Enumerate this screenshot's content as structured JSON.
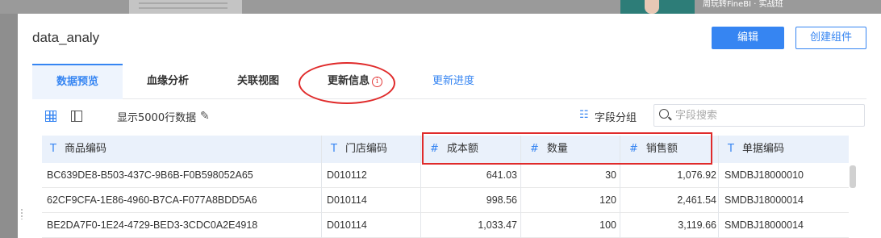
{
  "background": {
    "banner_text": "周玩转FineBI · 实战班"
  },
  "dialog": {
    "title": "data_analy",
    "edit_button": "编辑",
    "create_component_button": "创建组件"
  },
  "tabs": [
    {
      "label": "数据预览",
      "active": true
    },
    {
      "label": "血缘分析"
    },
    {
      "label": "关联视图"
    },
    {
      "label": "更新信息",
      "icon": "info-icon"
    },
    {
      "label": "更新进度"
    }
  ],
  "toolbar": {
    "rows_label": "显示5000行数据",
    "group_label": "字段分组",
    "search_placeholder": "字段搜索"
  },
  "table": {
    "columns": [
      {
        "type": "T",
        "label": "商品编码"
      },
      {
        "type": "T",
        "label": "门店编码"
      },
      {
        "type": "#",
        "label": "成本额"
      },
      {
        "type": "#",
        "label": "数量"
      },
      {
        "type": "#",
        "label": "销售额"
      },
      {
        "type": "T",
        "label": "单据编码"
      }
    ],
    "rows": [
      [
        "BC639DE8-B503-437C-9B6B-F0B598052A65",
        "D010112",
        "641.03",
        "30",
        "1,076.92",
        "SMDBJ18000010"
      ],
      [
        "62CF9CFA-1E86-4960-B7CA-F077A8BDD5A6",
        "D010114",
        "998.56",
        "120",
        "2,461.54",
        "SMDBJ18000014"
      ],
      [
        "BE2DA7F0-1E24-4729-BED3-3CDC0A2E4918",
        "D010114",
        "1,033.47",
        "100",
        "3,119.66",
        "SMDBJ18000014"
      ]
    ]
  },
  "colors": {
    "accent": "#3685f2",
    "annotation_red": "#e02b2b",
    "header_bg": "#eaf1fb"
  }
}
